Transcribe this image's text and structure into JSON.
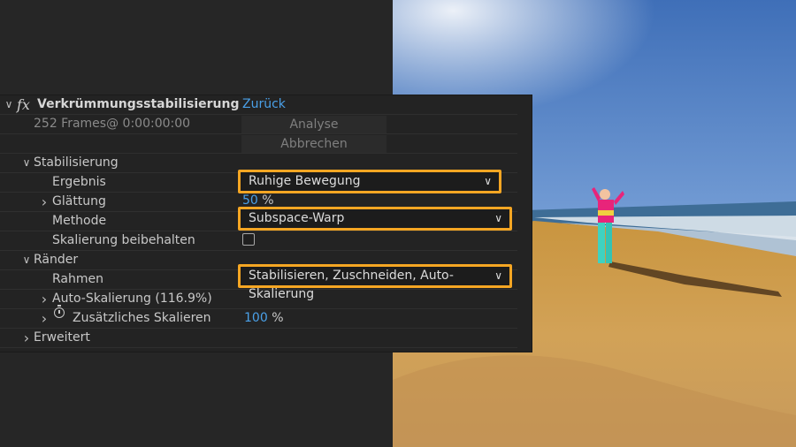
{
  "effect": {
    "name": "Verkrümmungsstabilisierung",
    "reset_label": "Zurück",
    "frames_info": "252 Frames@ 0:00:00:00",
    "analyze_label": "Analyse",
    "cancel_label": "Abbrechen"
  },
  "stabilization": {
    "section_label": "Stabilisierung",
    "result_label": "Ergebnis",
    "result_value": "Ruhige Bewegung",
    "smoothness_label": "Glättung",
    "smoothness_value": "50",
    "smoothness_unit": "%",
    "method_label": "Methode",
    "method_value": "Subspace-Warp",
    "preserve_scale_label": "Skalierung beibehalten",
    "preserve_scale_checked": false
  },
  "borders": {
    "section_label": "Ränder",
    "framing_label": "Rahmen",
    "framing_value": "Stabilisieren, Zuschneiden, Auto-Skalierung",
    "auto_scale_label": "Auto-Skalierung (116.9%)",
    "additional_scale_label": "Zusätzliches Skalieren",
    "additional_scale_value": "100",
    "additional_scale_unit": "%"
  },
  "advanced": {
    "section_label": "Erweitert"
  },
  "colors": {
    "highlight": "#f5a623",
    "link": "#4aa0e8",
    "panel_bg": "#232323"
  }
}
